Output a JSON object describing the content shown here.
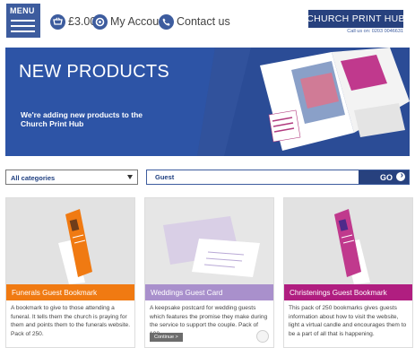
{
  "header": {
    "menu_label": "MENU",
    "basket_amount": "£3.00",
    "account_label": "My Account",
    "contact_label": "Contact us",
    "brand_name": "CHURCH PRINT HUB",
    "brand_phone": "Call us on: 0203 0046631"
  },
  "banner": {
    "title": "NEW PRODUCTS",
    "subtitle": "We're adding new products to the Church Print Hub"
  },
  "search": {
    "category_selected": "All categories",
    "query_value": "Guest",
    "go_label": "GO"
  },
  "products": [
    {
      "title": "Funerals Guest Bookmark",
      "description": "A bookmark to give to those attending a funeral. It tells them the church is praying for them and points them to the funerals website. Pack of 250.",
      "accent": "#f07a12"
    },
    {
      "title": "Weddings Guest Card",
      "description": "A keepsake postcard for wedding guests which features the promise they make during the service to support the couple. Pack of 100.",
      "continue_label": "Continue >",
      "accent": "#a990cc"
    },
    {
      "title": "Christenings Guest Bookmark",
      "description": "This pack of 250 bookmarks gives guests information about how to visit the website, light a virtual candle and encourages them to be a part of all that is happening.",
      "accent": "#b01e80"
    }
  ],
  "colors": {
    "brand_blue": "#27417e",
    "banner_blue": "#2d54a6",
    "menu_blue": "#3d5c9e"
  }
}
